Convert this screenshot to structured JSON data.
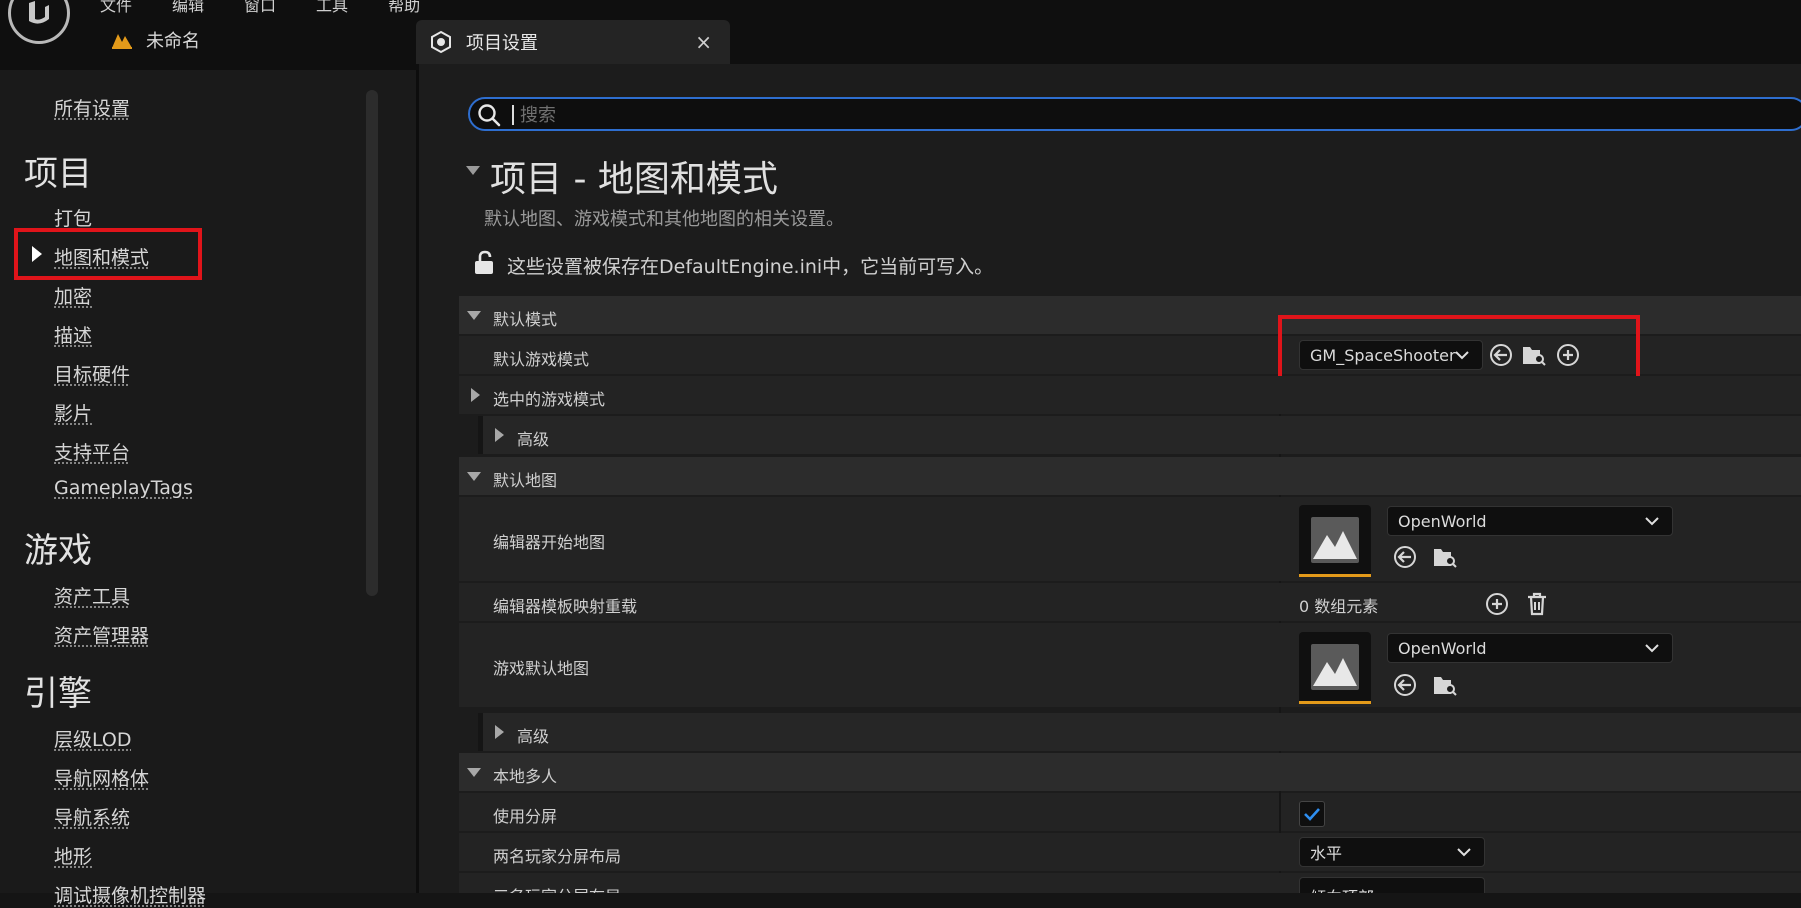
{
  "menu": [
    "文件",
    "编辑",
    "窗口",
    "工具",
    "帮助"
  ],
  "project_name": "未命名",
  "tab": {
    "label": "项目设置",
    "close": "×"
  },
  "sidebar": {
    "all_settings": "所有设置",
    "sections": [
      {
        "heading": "项目",
        "items": [
          "打包",
          "地图和模式",
          "加密",
          "描述",
          "目标硬件",
          "影片",
          "支持平台",
          "GameplayTags"
        ]
      },
      {
        "heading": "游戏",
        "items": [
          "资产工具",
          "资产管理器"
        ]
      },
      {
        "heading": "引擎",
        "items": [
          "层级LOD",
          "导航网格体",
          "导航系统",
          "地形",
          "调试摄像机控制器"
        ]
      }
    ],
    "selected": "地图和模式"
  },
  "search": {
    "placeholder": "搜索"
  },
  "page": {
    "title": "项目 - 地图和模式",
    "subtitle": "默认地图、游戏模式和其他地图的相关设置。",
    "saved_note": "这些设置被保存在DefaultEngine.ini中，它当前可写入。"
  },
  "default_modes": {
    "category": "默认模式",
    "default_game_mode_label": "默认游戏模式",
    "default_game_mode_value": "GM_SpaceShooter",
    "selected_game_mode_label": "选中的游戏模式",
    "advanced_label": "高级"
  },
  "default_maps": {
    "category": "默认地图",
    "editor_startup_map_label": "编辑器开始地图",
    "editor_startup_map_value": "OpenWorld",
    "template_override_label": "编辑器模板映射重载",
    "template_override_count": "0 数组元素",
    "game_default_map_label": "游戏默认地图",
    "game_default_map_value": "OpenWorld",
    "advanced_label": "高级"
  },
  "local_multiplayer": {
    "category": "本地多人",
    "use_splitscreen_label": "使用分屏",
    "use_splitscreen_checked": true,
    "two_player_layout_label": "两名玩家分屏布局",
    "two_player_layout_value": "水平",
    "three_player_layout_label": "三名玩家分屏布局",
    "three_player_layout_value": "倾向顶部"
  },
  "colors": {
    "accent": "#2e6ecf",
    "highlight": "#e0141a",
    "asset_bar": "#e39a1a"
  }
}
